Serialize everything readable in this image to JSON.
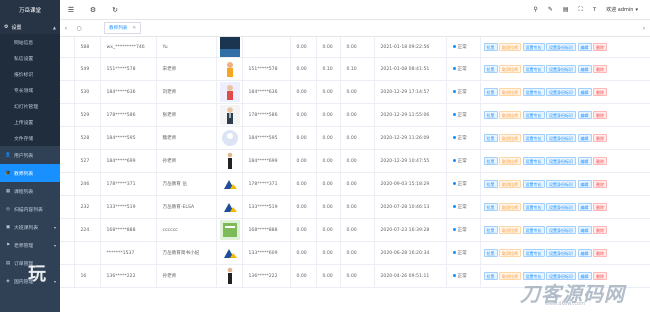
{
  "app_title": "万岳课堂",
  "sidebar": {
    "group": "设置",
    "sub_items": [
      "网站信息",
      "私信设置",
      "报价标识",
      "专长领域",
      "幻灯片管理",
      "上传设置",
      "文件存储"
    ],
    "items": [
      {
        "label": "用户列表",
        "icon": "user-icon",
        "active": false,
        "caret": false
      },
      {
        "label": "教师列表",
        "icon": "teacher-icon",
        "active": true,
        "caret": false
      },
      {
        "label": "课程列表",
        "icon": "book-icon",
        "active": false,
        "caret": false
      },
      {
        "label": "扫描内容列表",
        "icon": "scan-icon",
        "active": false,
        "caret": false
      },
      {
        "label": "大班课列表",
        "icon": "class-icon",
        "active": false,
        "caret": true
      },
      {
        "label": "老师管理",
        "icon": "manage-icon",
        "active": false,
        "caret": true
      },
      {
        "label": "订单管理",
        "icon": "order-icon",
        "active": false,
        "caret": false
      },
      {
        "label": "国内管理",
        "icon": "domestic-icon",
        "active": false,
        "caret": true
      }
    ],
    "overlay_text": "玩"
  },
  "topbar": {
    "left_icons": [
      "menu-icon",
      "settings-icon",
      "refresh-icon"
    ],
    "right_icons": [
      "pin-icon",
      "tool-icon",
      "doc-icon",
      "fullscreen-icon",
      "font-icon"
    ],
    "user": "欢迎 admin"
  },
  "tabs": {
    "active_tab": "教师列表"
  },
  "colors": {
    "accent": "#1890ff",
    "sidebar_bg": "#304156",
    "danger": "#ff4949",
    "warning": "#ff9a2e"
  },
  "actions": [
    "拉黑",
    "取消拉师",
    "设置专长",
    "设置身份标识",
    "编辑",
    "删除"
  ],
  "rows": [
    {
      "id": "588",
      "account": "wx_*********746",
      "name": "Yu",
      "thumb": "dark",
      "phone": "",
      "v1": "0.00",
      "v2": "0.00",
      "v3": "0.00",
      "time": "2021-01-18 09:22:56",
      "status": "正常"
    },
    {
      "id": "549",
      "account": "151*****578",
      "name": "宋老师",
      "thumb": "figure-orange",
      "phone": "151*****578",
      "v1": "0.00",
      "v2": "0.10",
      "v3": "0.10",
      "time": "2021-01-08 08:41:51",
      "status": "正常"
    },
    {
      "id": "530",
      "account": "184*****636",
      "name": "刘老师",
      "thumb": "figure-red",
      "phone": "184*****636",
      "v1": "0.00",
      "v2": "0.00",
      "v3": "0.00",
      "time": "2020-12-29 17:14:57",
      "status": "正常"
    },
    {
      "id": "529",
      "account": "178*****586",
      "name": "张老师",
      "thumb": "figure-suit",
      "phone": "178*****586",
      "v1": "0.00",
      "v2": "0.00",
      "v3": "0.00",
      "time": "2020-12-29 11:55:06",
      "status": "正常"
    },
    {
      "id": "528",
      "account": "184*****595",
      "name": "魏老师",
      "thumb": "avatar-blank",
      "phone": "184*****595",
      "v1": "0.00",
      "v2": "0.00",
      "v3": "0.00",
      "time": "2020-12-29 11:26:09",
      "status": "正常"
    },
    {
      "id": "527",
      "account": "184*****699",
      "name": "孙老师",
      "thumb": "figure-standing",
      "phone": "184*****699",
      "v1": "0.00",
      "v2": "0.00",
      "v3": "0.00",
      "time": "2020-12-29 10:47:55",
      "status": "正常"
    },
    {
      "id": "246",
      "account": "178*****371",
      "name": "万岳教育 岳",
      "thumb": "logo-mountain",
      "phone": "178*****371",
      "v1": "0.00",
      "v2": "0.00",
      "v3": "0.00",
      "time": "2020-09-03 15:18:29",
      "status": "正常"
    },
    {
      "id": "232",
      "account": "133*****519",
      "name": "万岳教育-ELSA",
      "thumb": "logo-mountain",
      "phone": "133*****519",
      "v1": "0.00",
      "v2": "0.00",
      "v3": "0.00",
      "time": "2020-07-28 10:46:13",
      "status": "正常"
    },
    {
      "id": "224",
      "account": "168*****888",
      "name": "cccccc",
      "thumb": "book-cover",
      "phone": "168*****888",
      "v1": "0.00",
      "v2": "0.00",
      "v3": "0.00",
      "time": "2020-07-23 16:39:28",
      "status": "正常"
    },
    {
      "id": "",
      "account": "*******1537",
      "name": "万岳教育简书小妃",
      "thumb": "logo-mountain",
      "phone": "133*****609",
      "v1": "0.00",
      "v2": "0.00",
      "v3": "0.00",
      "time": "2020-06-28 16:20:34",
      "status": "正常"
    },
    {
      "id": "16",
      "account": "136*****222",
      "name": "孙老师",
      "thumb": "figure-standing",
      "phone": "136*****222",
      "v1": "0.00",
      "v2": "0.00",
      "v3": "0.00",
      "time": "2020-04-26 09:51:11",
      "status": "正常"
    }
  ]
}
